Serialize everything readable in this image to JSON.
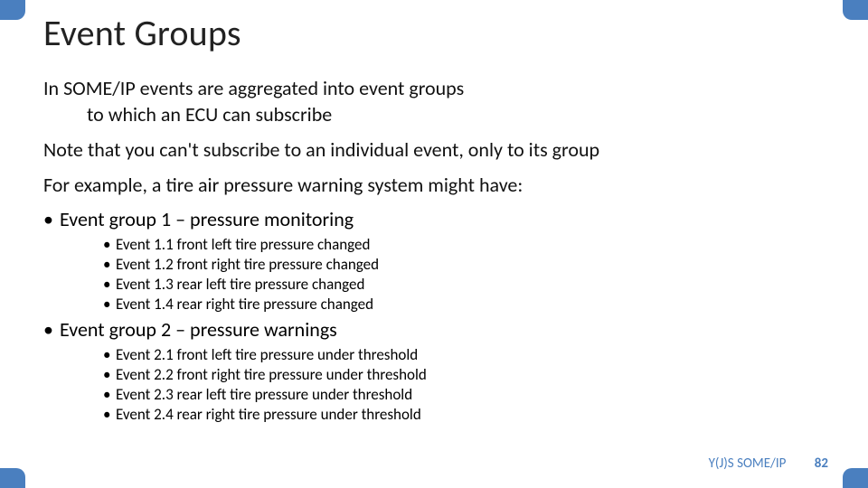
{
  "title": "Event Groups",
  "lead1_a": "In SOME/IP events are aggregated into event groups",
  "lead1_b": "to which an ECU can subscribe",
  "lead2": "Note that you can't subscribe to an individual event, only to its group",
  "lead3": "For example, a tire air pressure warning system might have:",
  "group1_label": "Event group 1 – pressure monitoring",
  "group1_items": [
    "Event 1.1 front left tire pressure changed",
    "Event 1.2 front right tire pressure changed",
    "Event 1.3 rear left tire pressure changed",
    "Event 1.4 rear right tire pressure changed"
  ],
  "group2_label": "Event group 2 – pressure warnings",
  "group2_items": [
    "Event 2.1 front left tire pressure under threshold",
    "Event 2.2 front right tire pressure under threshold",
    "Event 2.3 rear left tire pressure under threshold",
    "Event 2.4 rear right tire pressure under threshold"
  ],
  "footer_label": "Y(J)S  SOME/IP",
  "footer_page": "82",
  "accent_color": "#4a7fbf"
}
